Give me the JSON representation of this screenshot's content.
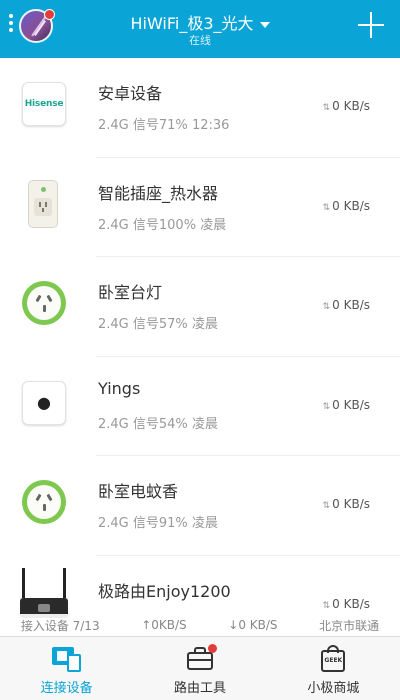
{
  "header": {
    "title": "HiWiFi_极3_光大",
    "subtitle": "在线",
    "bg_color": "#0aa4d6"
  },
  "devices": [
    {
      "name": "安卓设备",
      "band": "2.4G",
      "signal": "信号71%",
      "time": "12:36",
      "rate": "0 KB/s",
      "icon": "hisense-tv-icon",
      "brand_text": "Hisense"
    },
    {
      "name": "智能插座_热水器",
      "band": "2.4G",
      "signal": "信号100%",
      "time": "凌晨",
      "rate": "0 KB/s",
      "icon": "smart-plug-icon"
    },
    {
      "name": "卧室台灯",
      "band": "2.4G",
      "signal": "信号57%",
      "time": "凌晨",
      "rate": "0 KB/s",
      "icon": "round-socket-icon"
    },
    {
      "name": "Yings",
      "band": "2.4G",
      "signal": "信号54%",
      "time": "凌晨",
      "rate": "0 KB/s",
      "icon": "apple-mac-icon"
    },
    {
      "name": "卧室电蚊香",
      "band": "2.4G",
      "signal": "信号91%",
      "time": "凌晨",
      "rate": "0 KB/s",
      "icon": "round-socket-icon"
    },
    {
      "name": "极路由Enjoy1200",
      "band": "",
      "signal": "",
      "time": "",
      "rate": "0 KB/s",
      "icon": "router-icon"
    }
  ],
  "status_bar": {
    "connected": "接入设备 7/13",
    "upload": "↑0KB/S",
    "download": "↓0 KB/S",
    "isp": "北京市联通"
  },
  "tabs": [
    {
      "label": "连接设备",
      "active": true,
      "icon": "devices-icon"
    },
    {
      "label": "路由工具",
      "active": false,
      "icon": "toolbox-icon"
    },
    {
      "label": "小极商城",
      "active": false,
      "icon": "geek-store-icon"
    }
  ],
  "colors": {
    "accent": "#0aa4d6",
    "badge_red": "#e43b3b",
    "socket_green": "#7ec850"
  }
}
